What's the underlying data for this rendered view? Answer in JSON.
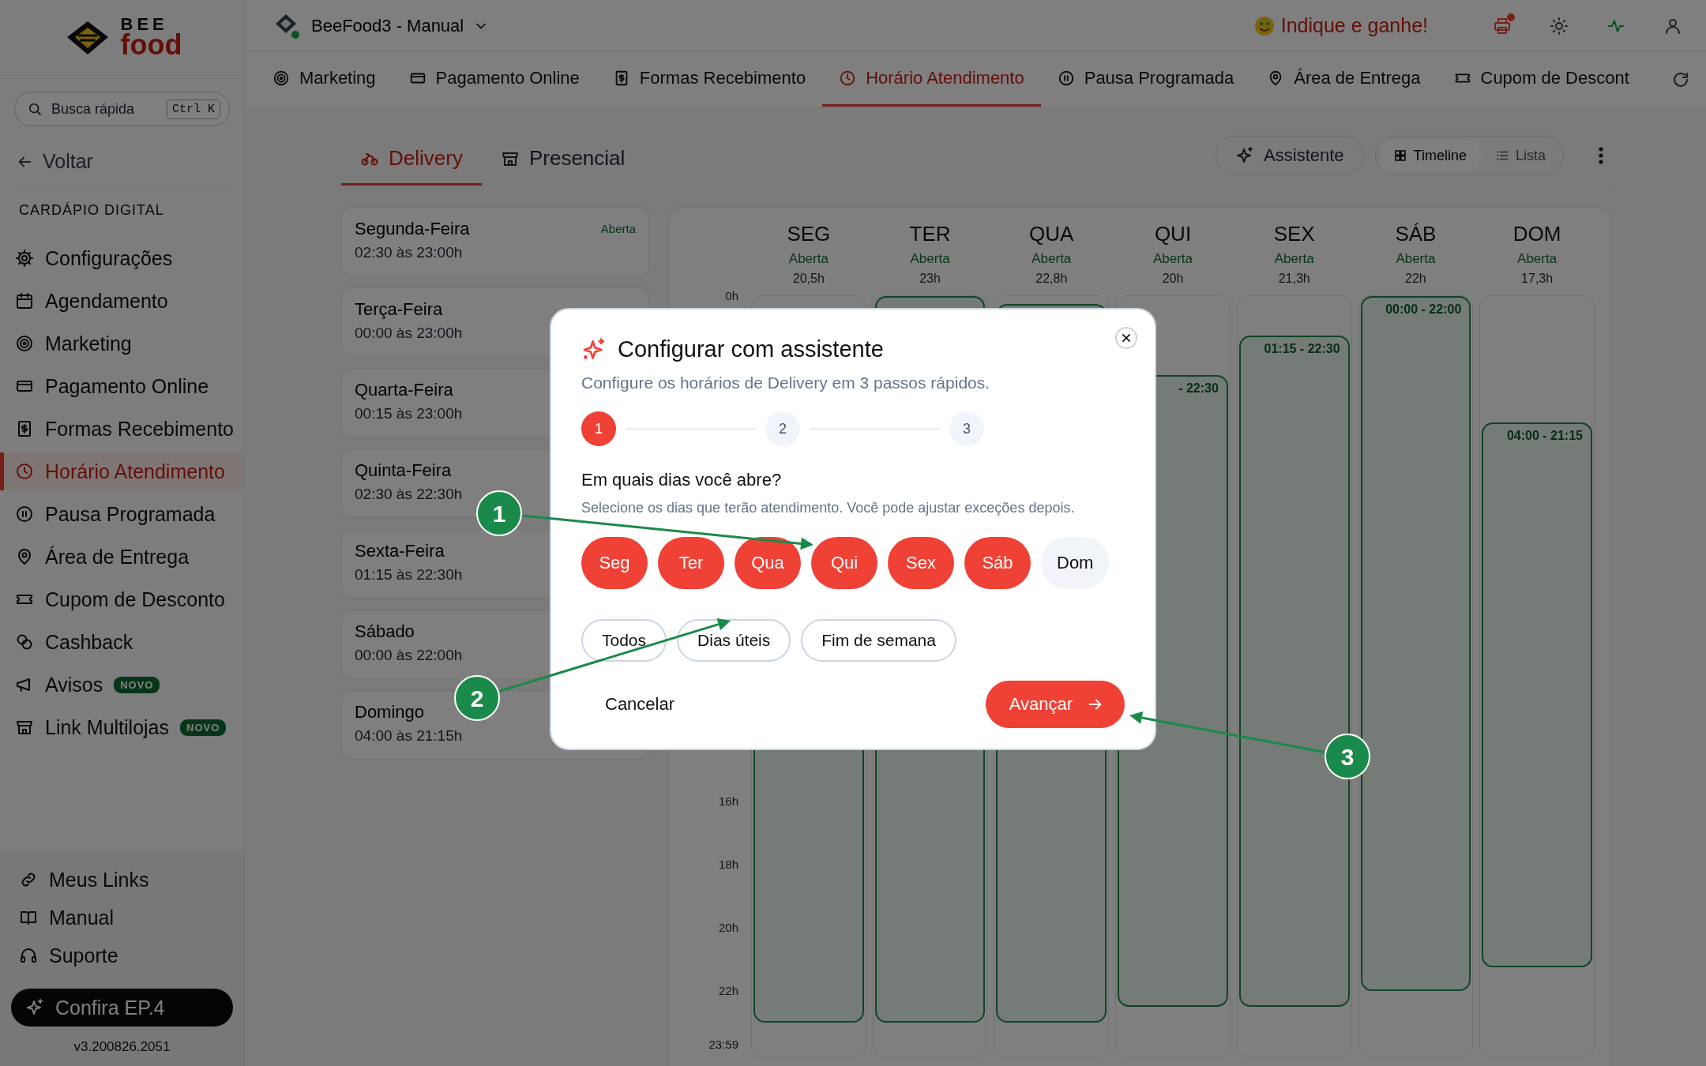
{
  "sidebar": {
    "logo": {
      "top": "BEE",
      "bottom": "food"
    },
    "search": {
      "placeholder": "Busca rápida",
      "shortcut": "Ctrl K"
    },
    "back": "Voltar",
    "section": "CARDÁPIO DIGITAL",
    "items": [
      {
        "label": "Configurações",
        "selected": false
      },
      {
        "label": "Agendamento",
        "selected": false
      },
      {
        "label": "Marketing",
        "selected": false
      },
      {
        "label": "Pagamento Online",
        "selected": false
      },
      {
        "label": "Formas Recebimento",
        "selected": false
      },
      {
        "label": "Horário Atendimento",
        "selected": true
      },
      {
        "label": "Pausa Programada",
        "selected": false
      },
      {
        "label": "Área de Entrega",
        "selected": false
      },
      {
        "label": "Cupom de Desconto",
        "selected": false
      },
      {
        "label": "Cashback",
        "selected": false
      },
      {
        "label": "Avisos",
        "selected": false,
        "badge": "NOVO"
      },
      {
        "label": "Link Multilojas",
        "selected": false,
        "badge": "NOVO"
      }
    ],
    "footer_links": [
      "Meus Links",
      "Manual",
      "Suporte"
    ],
    "promo_button": "Confira EP.4",
    "version": "v3.200826.2051"
  },
  "topbar": {
    "store": "BeeFood3 - Manual",
    "referral": "Indique e ganhe!",
    "printer_alert": true
  },
  "tabs": [
    {
      "label": "Marketing",
      "selected": false
    },
    {
      "label": "Pagamento Online",
      "selected": false
    },
    {
      "label": "Formas Recebimento",
      "selected": false
    },
    {
      "label": "Horário Atendimento",
      "selected": true
    },
    {
      "label": "Pausa Programada",
      "selected": false
    },
    {
      "label": "Área de Entrega",
      "selected": false
    },
    {
      "label": "Cupom de Descont",
      "selected": false
    }
  ],
  "mode_tabs": [
    {
      "label": "Delivery",
      "selected": true
    },
    {
      "label": "Presencial",
      "selected": false
    }
  ],
  "toolbar": {
    "assistant": "Assistente",
    "views": [
      {
        "label": "Timeline",
        "selected": true
      },
      {
        "label": "Lista",
        "selected": false
      }
    ]
  },
  "days": [
    {
      "name": "Segunda-Feira",
      "hours": "02:30 às 23:00h",
      "status": "Aberta"
    },
    {
      "name": "Terça-Feira",
      "hours": "00:00 às 23:00h"
    },
    {
      "name": "Quarta-Feira",
      "hours": "00:15 às 23:00h"
    },
    {
      "name": "Quinta-Feira",
      "hours": "02:30 às 22:30h"
    },
    {
      "name": "Sexta-Feira",
      "hours": "01:15 às 22:30h"
    },
    {
      "name": "Sábado",
      "hours": "00:00 às 22:00h"
    },
    {
      "name": "Domingo",
      "hours": "04:00 às 21:15h"
    }
  ],
  "timeline": {
    "hours": [
      "0h",
      "16h",
      "18h",
      "20h",
      "22h",
      "23:59"
    ],
    "columns": [
      {
        "day": "SEG",
        "status": "Aberta",
        "total": "20,5h"
      },
      {
        "day": "TER",
        "status": "Aberta",
        "total": "23h"
      },
      {
        "day": "QUA",
        "status": "Aberta",
        "total": "22,8h"
      },
      {
        "day": "QUI",
        "status": "Aberta",
        "total": "20h",
        "block_label": "- 22:30"
      },
      {
        "day": "SEX",
        "status": "Aberta",
        "total": "21,3h",
        "block_label": "01:15 - 22:30"
      },
      {
        "day": "SÁB",
        "status": "Aberta",
        "total": "22h",
        "block_label": "00:00 - 22:00"
      },
      {
        "day": "DOM",
        "status": "Aberta",
        "total": "17,3h",
        "block_label": "04:00 - 21:15"
      }
    ]
  },
  "dialog": {
    "title": "Configurar com assistente",
    "subtitle": "Configure os horários de Delivery em 3 passos rápidos.",
    "steps": [
      {
        "label": "1",
        "selected": true
      },
      {
        "label": "2",
        "selected": false
      },
      {
        "label": "3",
        "selected": false
      }
    ],
    "question": "Em quais dias você abre?",
    "hint": "Selecione os dias que terão atendimento. Você pode ajustar exceções depois.",
    "day_chips": [
      {
        "label": "Seg",
        "selected": true
      },
      {
        "label": "Ter",
        "selected": true
      },
      {
        "label": "Qua",
        "selected": true
      },
      {
        "label": "Qui",
        "selected": true
      },
      {
        "label": "Sex",
        "selected": true
      },
      {
        "label": "Sáb",
        "selected": true
      },
      {
        "label": "Dom",
        "selected": false
      }
    ],
    "presets": [
      "Todos",
      "Dias úteis",
      "Fim de semana"
    ],
    "cancel": "Cancelar",
    "next": "Avançar"
  },
  "callouts": [
    {
      "label": "1"
    },
    {
      "label": "2"
    },
    {
      "label": "3"
    }
  ]
}
